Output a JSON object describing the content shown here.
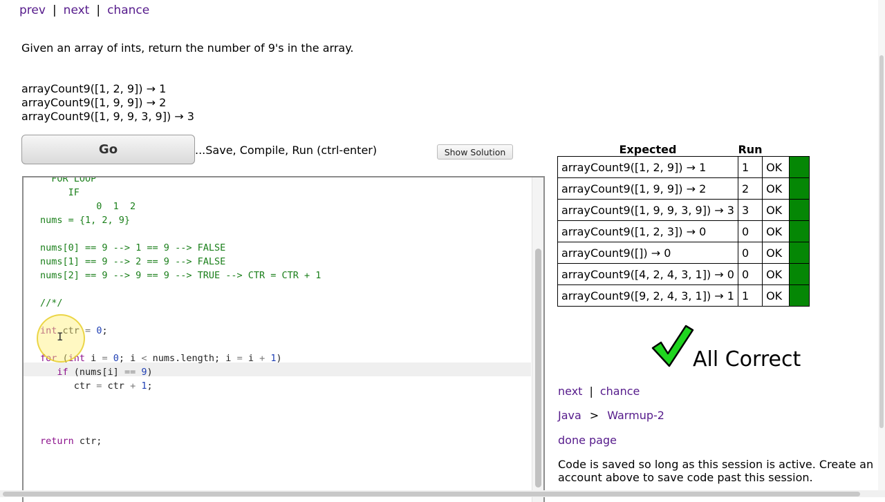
{
  "nav": {
    "prev": "prev",
    "next": "next",
    "chance": "chance",
    "sep": "|"
  },
  "problem": {
    "description": "Given an array of ints, return the number of 9's in the array.",
    "examples": [
      "arrayCount9([1, 2, 9]) → 1",
      "arrayCount9([1, 9, 9]) → 2",
      "arrayCount9([1, 9, 9, 3, 9]) → 3"
    ]
  },
  "controls": {
    "go_label": "Go",
    "go_hint": "...Save, Compile, Run (ctrl-enter)",
    "show_solution": "Show Solution"
  },
  "editor": {
    "lines": [
      {
        "text": "  FOR LOOP",
        "cls": "comment"
      },
      {
        "text": "     IF",
        "cls": "comment"
      },
      {
        "text": "          0  1  2",
        "cls": "comment"
      },
      {
        "text": "nums = {1, 2, 9}",
        "cls": "comment"
      },
      {
        "text": "",
        "cls": "comment"
      },
      {
        "text": "nums[0] == 9 --> 1 == 9 --> FALSE",
        "cls": "comment"
      },
      {
        "text": "nums[1] == 9 --> 2 == 9 --> FALSE",
        "cls": "comment"
      },
      {
        "text": "nums[2] == 9 --> 9 == 9 --> TRUE --> CTR = CTR + 1",
        "cls": "comment"
      },
      {
        "text": "",
        "cls": "comment"
      },
      {
        "text": "//*/",
        "cls": "comment"
      },
      {
        "text": "",
        "cls": "comment"
      },
      {
        "segments": [
          [
            "int",
            "kw"
          ],
          [
            " ctr ",
            "var"
          ],
          [
            "=",
            "op"
          ],
          [
            " ",
            "var"
          ],
          [
            "0",
            "num"
          ],
          [
            ";",
            "var"
          ]
        ]
      },
      {
        "text": "",
        "cls": "var"
      },
      {
        "segments": [
          [
            "for",
            "kw"
          ],
          [
            " (",
            "var"
          ],
          [
            "int",
            "kw"
          ],
          [
            " i ",
            "var"
          ],
          [
            "=",
            "op"
          ],
          [
            " ",
            "var"
          ],
          [
            "0",
            "num"
          ],
          [
            "; i ",
            "var"
          ],
          [
            "<",
            "op"
          ],
          [
            " nums.length; i ",
            "var"
          ],
          [
            "=",
            "op"
          ],
          [
            " i ",
            "var"
          ],
          [
            "+",
            "op"
          ],
          [
            " ",
            "var"
          ],
          [
            "1",
            "num"
          ],
          [
            ")",
            "var"
          ]
        ]
      },
      {
        "segments": [
          [
            "   ",
            "var"
          ],
          [
            "if",
            "kw"
          ],
          [
            " (nums[i] ",
            "var"
          ],
          [
            "==",
            "op"
          ],
          [
            " ",
            "var"
          ],
          [
            "9",
            "num"
          ],
          [
            ")",
            "var"
          ]
        ]
      },
      {
        "segments": [
          [
            "      ctr ",
            "var"
          ],
          [
            "=",
            "op"
          ],
          [
            " ctr ",
            "var"
          ],
          [
            "+",
            "op"
          ],
          [
            " ",
            "var"
          ],
          [
            "1",
            "num"
          ],
          [
            ";",
            "var"
          ]
        ]
      },
      {
        "text": "",
        "cls": "var"
      },
      {
        "text": "",
        "cls": "var"
      },
      {
        "text": "",
        "cls": "var"
      },
      {
        "segments": [
          [
            "return",
            "kw"
          ],
          [
            " ctr;",
            "var"
          ]
        ]
      }
    ]
  },
  "results": {
    "headers": {
      "expected": "Expected",
      "run": "Run"
    },
    "rows": [
      {
        "expected": "arrayCount9([1, 2, 9]) → 1",
        "run": "1",
        "status": "OK"
      },
      {
        "expected": "arrayCount9([1, 9, 9]) → 2",
        "run": "2",
        "status": "OK"
      },
      {
        "expected": "arrayCount9([1, 9, 9, 3, 9]) → 3",
        "run": "3",
        "status": "OK"
      },
      {
        "expected": "arrayCount9([1, 2, 3]) → 0",
        "run": "0",
        "status": "OK"
      },
      {
        "expected": "arrayCount9([]) → 0",
        "run": "0",
        "status": "OK"
      },
      {
        "expected": "arrayCount9([4, 2, 4, 3, 1]) → 0",
        "run": "0",
        "status": "OK"
      },
      {
        "expected": "arrayCount9([9, 2, 4, 3, 1]) → 1",
        "run": "1",
        "status": "OK"
      }
    ],
    "pass_color": "#058705",
    "summary": "All Correct",
    "check_color": "#1fd41f"
  },
  "side": {
    "next": "next",
    "chance": "chance",
    "sep": "|",
    "breadcrumb": {
      "lang": "Java",
      "sep": ">",
      "section": "Warmup-2"
    },
    "done": "done page",
    "note": "Code is saved so long as this session is active. Create an account above to save code past this session."
  },
  "icons": {
    "check": "check-mark-icon",
    "cursor": "text-cursor-icon"
  }
}
